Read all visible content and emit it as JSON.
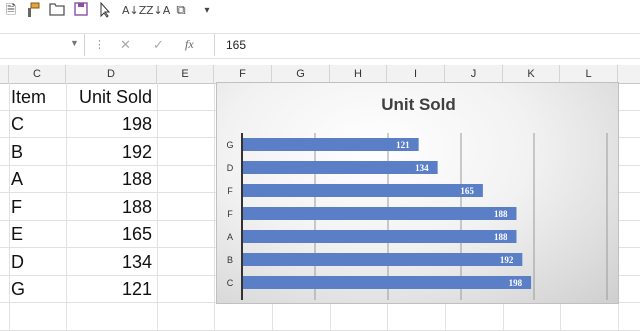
{
  "toolbar": {
    "icons": [
      "note-icon",
      "format-painter-icon",
      "open-folder-icon",
      "save-icon",
      "pointer-icon",
      "sort-ascending-icon",
      "sort-descending-icon",
      "compare-icon",
      "dropdown-icon"
    ]
  },
  "formula_bar": {
    "name_box": "",
    "value": "165",
    "fx_label": "fx"
  },
  "columns": [
    "C",
    "D",
    "E",
    "F",
    "G",
    "H",
    "I",
    "J",
    "K",
    "L"
  ],
  "table": {
    "header_item": "Item",
    "header_unit": "Unit Sold",
    "rows": [
      {
        "item": "C",
        "unit": "198"
      },
      {
        "item": "B",
        "unit": "192"
      },
      {
        "item": "A",
        "unit": "188"
      },
      {
        "item": "F",
        "unit": "188"
      },
      {
        "item": "E",
        "unit": "165"
      },
      {
        "item": "D",
        "unit": "134"
      },
      {
        "item": "G",
        "unit": "121"
      }
    ]
  },
  "chart_data": {
    "type": "bar",
    "orientation": "horizontal",
    "title": "Unit Sold",
    "categories": [
      "G",
      "D",
      "F",
      "F",
      "A",
      "B",
      "C"
    ],
    "values": [
      121,
      134,
      165,
      188,
      188,
      192,
      198
    ],
    "xlim": [
      0,
      250
    ],
    "bar_color": "#5b7fc7",
    "data_label_color": "#ffffff",
    "grid": true,
    "legend": "none"
  }
}
